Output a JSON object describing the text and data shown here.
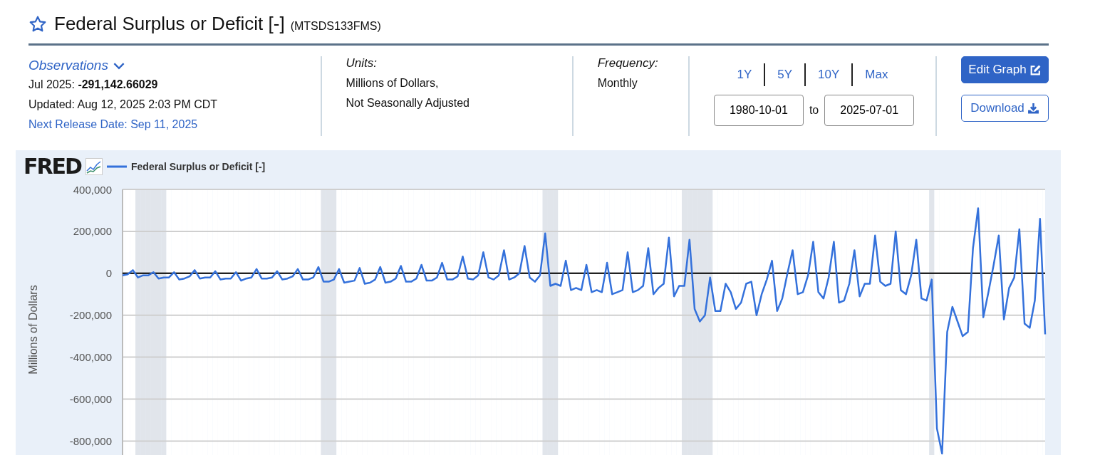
{
  "header": {
    "title": "Federal Surplus or Deficit [-]",
    "series_id": "(MTSDS133FMS)"
  },
  "observations": {
    "toggle": "Observations",
    "latest_label": "Jul 2025:",
    "latest_value": "-291,142.66029",
    "updated": "Updated: Aug 12, 2025 2:03 PM CDT",
    "next_release": "Next Release Date: Sep 11, 2025"
  },
  "units": {
    "label": "Units:",
    "lines": [
      "Millions of Dollars,",
      "Not Seasonally Adjusted"
    ]
  },
  "frequency": {
    "label": "Frequency:",
    "value": "Monthly"
  },
  "range": {
    "presets": [
      "1Y",
      "5Y",
      "10Y",
      "Max"
    ],
    "start": "1980-10-01",
    "separator": "to",
    "end": "2025-07-01"
  },
  "actions": {
    "edit": "Edit Graph",
    "download": "Download"
  },
  "chart": {
    "logo": "FRED",
    "recession_shading": [
      false,
      false,
      false,
      true,
      true,
      true,
      true,
      true,
      true,
      false,
      false,
      false,
      false,
      false,
      false,
      false,
      false,
      false,
      false,
      false,
      false,
      false,
      false,
      false,
      false,
      false,
      false,
      false,
      false,
      false,
      false,
      false,
      false,
      false,
      false,
      false,
      false,
      false,
      false,
      true,
      true,
      true,
      false,
      false,
      false,
      false,
      false,
      false,
      false,
      false,
      false,
      false,
      false,
      false,
      false,
      false,
      false,
      false,
      false,
      false,
      false,
      false,
      false,
      false,
      false,
      false,
      false,
      false,
      false,
      false,
      false,
      false,
      false,
      false,
      false,
      false,
      false,
      false,
      false,
      false,
      false,
      false,
      true,
      true,
      true,
      false,
      false,
      false,
      false,
      false,
      false,
      false,
      false,
      false,
      false,
      false,
      false,
      false,
      false,
      false,
      false,
      false,
      false,
      false,
      false,
      false,
      false,
      false,
      false,
      true,
      true,
      true,
      true,
      true,
      true,
      false,
      false,
      false,
      false,
      false,
      false,
      false,
      false,
      false,
      false,
      false,
      false,
      false,
      false,
      false,
      false,
      false,
      false,
      false,
      false,
      false,
      false,
      false,
      false,
      false,
      false,
      false,
      false,
      false,
      false,
      false,
      false,
      false,
      false,
      false,
      false,
      false,
      false,
      false,
      false,
      false,
      false,
      true,
      false,
      false,
      false,
      false,
      false,
      false,
      false,
      false,
      false,
      false,
      false,
      false,
      false,
      false,
      false,
      false,
      false,
      false,
      false,
      false,
      false,
      false
    ],
    "chart_data": {
      "type": "line",
      "ylabel": "Millions of Dollars",
      "ylim": [
        -870000,
        400000
      ],
      "yticks": [
        {
          "value": 400000,
          "label": "400,000"
        },
        {
          "value": 200000,
          "label": "200,000"
        },
        {
          "value": 0,
          "label": "0"
        },
        {
          "value": -200000,
          "label": "-200,000"
        },
        {
          "value": -400000,
          "label": "-400,000"
        },
        {
          "value": -600000,
          "label": "-600,000"
        },
        {
          "value": -800000,
          "label": "-800,000"
        }
      ],
      "grid": true,
      "categories": [
        null,
        null,
        null,
        null,
        null,
        null,
        null,
        null,
        null,
        null,
        null,
        null,
        null,
        null,
        null,
        null,
        null,
        null,
        null,
        null,
        null,
        null,
        null,
        null,
        null,
        null,
        null,
        null,
        null,
        null,
        null,
        null,
        null,
        null,
        null,
        null,
        null,
        null,
        null,
        null,
        null,
        null,
        null,
        null,
        null,
        null,
        null,
        null,
        null,
        null,
        null,
        null,
        null,
        null,
        null,
        null,
        null,
        null,
        null,
        null,
        null,
        null,
        null,
        null,
        null,
        null,
        null,
        null,
        null,
        null,
        null,
        null,
        null,
        null,
        null,
        null,
        null,
        null,
        null,
        null,
        null,
        null,
        null,
        null,
        null,
        null,
        null,
        null,
        null,
        null,
        null,
        null,
        null,
        null,
        null,
        null,
        null,
        null,
        null,
        null,
        null,
        null,
        null,
        null,
        null,
        null,
        null,
        null,
        null,
        null,
        null,
        null,
        null,
        null,
        null,
        null,
        null,
        null,
        null,
        null,
        null,
        null,
        null,
        null,
        null,
        null,
        null,
        null,
        null,
        null,
        null,
        null,
        null,
        null,
        null,
        null,
        null,
        null,
        null,
        null,
        null,
        null,
        null,
        null,
        null,
        null,
        null,
        null,
        null,
        null,
        null,
        null,
        null,
        null,
        null,
        null,
        null,
        null,
        null,
        null,
        null,
        null,
        null,
        null,
        null,
        null,
        null,
        null,
        null,
        null,
        null,
        null,
        null,
        null,
        null,
        null,
        null,
        null,
        null,
        null
      ],
      "series": [
        {
          "name": "Federal Surplus or Deficit [-]",
          "color": "#3471db",
          "values": [
            -10000,
            -5000,
            15000,
            -20000,
            -10000,
            -10000,
            5000,
            -25000,
            -20000,
            -20000,
            5000,
            -30000,
            -25000,
            -15000,
            15000,
            -25000,
            -20000,
            -20000,
            10000,
            -30000,
            -25000,
            -25000,
            5000,
            -35000,
            -25000,
            -20000,
            20000,
            -25000,
            -25000,
            -20000,
            10000,
            -30000,
            -25000,
            -15000,
            20000,
            -30000,
            -30000,
            -20000,
            30000,
            -40000,
            -40000,
            -30000,
            20000,
            -45000,
            -40000,
            -35000,
            25000,
            -50000,
            -45000,
            -30000,
            30000,
            -45000,
            -40000,
            -25000,
            35000,
            -40000,
            -40000,
            -25000,
            40000,
            -35000,
            -35000,
            -20000,
            50000,
            -30000,
            -30000,
            -15000,
            80000,
            -25000,
            -30000,
            -10000,
            100000,
            -20000,
            -30000,
            -10000,
            110000,
            -30000,
            -20000,
            0,
            130000,
            -20000,
            -40000,
            -10000,
            190000,
            -60000,
            -50000,
            -60000,
            60000,
            -80000,
            -70000,
            -80000,
            40000,
            -90000,
            -80000,
            -90000,
            50000,
            -100000,
            -90000,
            -80000,
            100000,
            -90000,
            -80000,
            -60000,
            120000,
            -100000,
            -70000,
            -50000,
            170000,
            -110000,
            -60000,
            -60000,
            160000,
            -170000,
            -230000,
            -200000,
            -20000,
            -180000,
            -180000,
            -50000,
            -90000,
            -170000,
            -140000,
            -50000,
            -40000,
            -200000,
            -100000,
            -30000,
            60000,
            -180000,
            -120000,
            0,
            110000,
            -100000,
            -90000,
            -10000,
            150000,
            -90000,
            -120000,
            -20000,
            150000,
            -140000,
            -130000,
            -50000,
            110000,
            -110000,
            -50000,
            -50000,
            180000,
            -40000,
            -60000,
            -50000,
            200000,
            -80000,
            -100000,
            -10000,
            160000,
            -120000,
            -130000,
            -30000,
            -740000,
            -860000,
            -280000,
            -160000,
            -230000,
            -300000,
            -280000,
            120000,
            310000,
            -210000,
            -90000,
            40000,
            180000,
            -220000,
            -70000,
            -20000,
            210000,
            -240000,
            -260000,
            -130000,
            260000,
            -291000
          ]
        }
      ]
    }
  }
}
